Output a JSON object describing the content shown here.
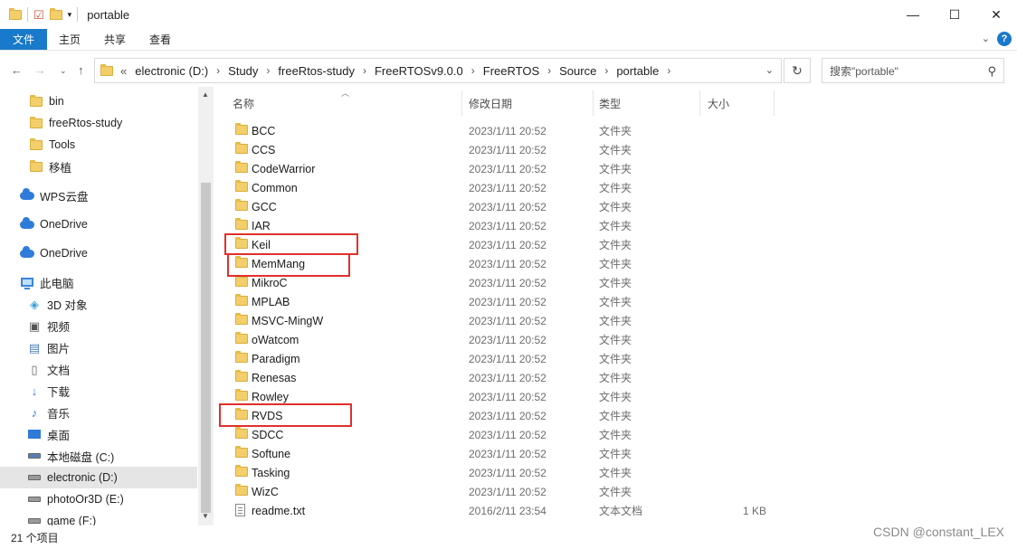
{
  "window": {
    "title": "portable",
    "minimize": "—",
    "maximize": "☐",
    "close": "✕"
  },
  "ribbon": {
    "tabs": [
      "文件",
      "主页",
      "共享",
      "查看"
    ],
    "help": "?"
  },
  "address": {
    "overflow": "«",
    "crumbs": [
      "electronic (D:)",
      "Study",
      "freeRtos-study",
      "FreeRTOSv9.0.0",
      "FreeRTOS",
      "Source",
      "portable"
    ]
  },
  "search": {
    "placeholder": "搜索\"portable\""
  },
  "columns": {
    "name": "名称",
    "date": "修改日期",
    "type": "类型",
    "size": "大小"
  },
  "nav": [
    {
      "label": "bin",
      "icon": "folder-icon"
    },
    {
      "label": "freeRtos-study",
      "icon": "folder-icon"
    },
    {
      "label": "Tools",
      "icon": "folder-icon"
    },
    {
      "label": "移植",
      "icon": "folder-icon"
    },
    {
      "label": "WPS云盘",
      "icon": "cloud-icon"
    },
    {
      "label": "OneDrive",
      "icon": "cloud-icon"
    },
    {
      "label": "OneDrive",
      "icon": "cloud-icon"
    },
    {
      "label": "此电脑",
      "icon": "pc-icon"
    },
    {
      "label": "3D 对象",
      "icon": "cube-icon"
    },
    {
      "label": "视频",
      "icon": "video-icon"
    },
    {
      "label": "图片",
      "icon": "picture-icon"
    },
    {
      "label": "文档",
      "icon": "document-icon"
    },
    {
      "label": "下载",
      "icon": "download-icon"
    },
    {
      "label": "音乐",
      "icon": "music-icon"
    },
    {
      "label": "桌面",
      "icon": "desktop-icon"
    },
    {
      "label": "本地磁盘 (C:)",
      "icon": "drive-icon"
    },
    {
      "label": "electronic (D:)",
      "icon": "drive-icon"
    },
    {
      "label": "photoOr3D (E:)",
      "icon": "drive-icon"
    },
    {
      "label": "game (F:)",
      "icon": "drive-icon"
    }
  ],
  "files": [
    {
      "name": "BCC",
      "date": "2023/1/11 20:52",
      "type": "文件夹",
      "size": ""
    },
    {
      "name": "CCS",
      "date": "2023/1/11 20:52",
      "type": "文件夹",
      "size": ""
    },
    {
      "name": "CodeWarrior",
      "date": "2023/1/11 20:52",
      "type": "文件夹",
      "size": ""
    },
    {
      "name": "Common",
      "date": "2023/1/11 20:52",
      "type": "文件夹",
      "size": ""
    },
    {
      "name": "GCC",
      "date": "2023/1/11 20:52",
      "type": "文件夹",
      "size": ""
    },
    {
      "name": "IAR",
      "date": "2023/1/11 20:52",
      "type": "文件夹",
      "size": ""
    },
    {
      "name": "Keil",
      "date": "2023/1/11 20:52",
      "type": "文件夹",
      "size": ""
    },
    {
      "name": "MemMang",
      "date": "2023/1/11 20:52",
      "type": "文件夹",
      "size": ""
    },
    {
      "name": "MikroC",
      "date": "2023/1/11 20:52",
      "type": "文件夹",
      "size": ""
    },
    {
      "name": "MPLAB",
      "date": "2023/1/11 20:52",
      "type": "文件夹",
      "size": ""
    },
    {
      "name": "MSVC-MingW",
      "date": "2023/1/11 20:52",
      "type": "文件夹",
      "size": ""
    },
    {
      "name": "oWatcom",
      "date": "2023/1/11 20:52",
      "type": "文件夹",
      "size": ""
    },
    {
      "name": "Paradigm",
      "date": "2023/1/11 20:52",
      "type": "文件夹",
      "size": ""
    },
    {
      "name": "Renesas",
      "date": "2023/1/11 20:52",
      "type": "文件夹",
      "size": ""
    },
    {
      "name": "Rowley",
      "date": "2023/1/11 20:52",
      "type": "文件夹",
      "size": ""
    },
    {
      "name": "RVDS",
      "date": "2023/1/11 20:52",
      "type": "文件夹",
      "size": ""
    },
    {
      "name": "SDCC",
      "date": "2023/1/11 20:52",
      "type": "文件夹",
      "size": ""
    },
    {
      "name": "Softune",
      "date": "2023/1/11 20:52",
      "type": "文件夹",
      "size": ""
    },
    {
      "name": "Tasking",
      "date": "2023/1/11 20:52",
      "type": "文件夹",
      "size": ""
    },
    {
      "name": "WizC",
      "date": "2023/1/11 20:52",
      "type": "文件夹",
      "size": ""
    },
    {
      "name": "readme.txt",
      "date": "2016/2/11 23:54",
      "type": "文本文档",
      "size": "1 KB"
    }
  ],
  "status": {
    "count": "21 个项目"
  },
  "watermark": "CSDN @constant_LEX",
  "colors": {
    "accent": "#1979ca",
    "annotation": "#e0302d",
    "selected": "#e5e5e5"
  }
}
